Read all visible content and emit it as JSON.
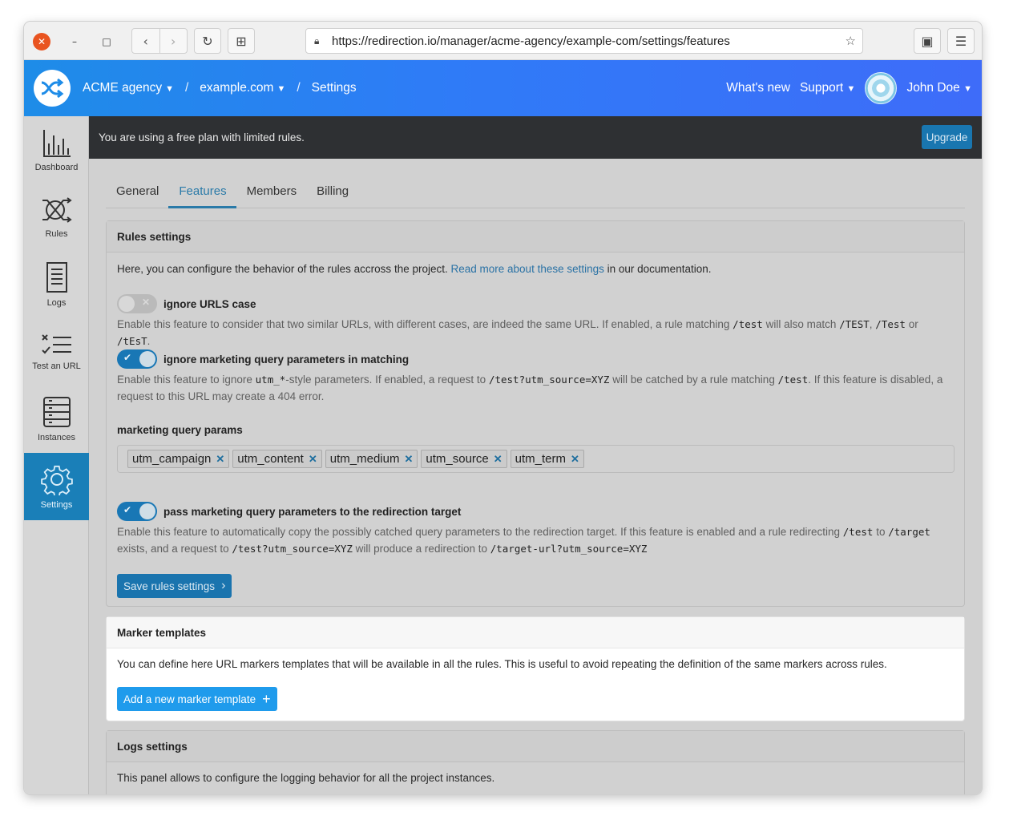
{
  "browser": {
    "url": "https://redirection.io/manager/acme-agency/example-com/settings/features"
  },
  "header": {
    "org": "ACME agency",
    "project": "example.com",
    "section": "Settings",
    "sep": "/",
    "whats_new": "What's new",
    "support": "Support",
    "user": "John Doe"
  },
  "sidebar": {
    "items": [
      {
        "label": "Dashboard"
      },
      {
        "label": "Rules"
      },
      {
        "label": "Logs"
      },
      {
        "label": "Test an URL"
      },
      {
        "label": "Instances"
      },
      {
        "label": "Settings"
      }
    ]
  },
  "banner": {
    "text": "You are using a free plan with limited rules.",
    "upgrade": "Upgrade"
  },
  "tabs": [
    {
      "label": "General"
    },
    {
      "label": "Features"
    },
    {
      "label": "Members"
    },
    {
      "label": "Billing"
    }
  ],
  "rules_panel": {
    "title": "Rules settings",
    "intro_pre": "Here, you can configure the behavior of the rules accross the project.",
    "intro_link": "Read more about these settings",
    "intro_post": "in our documentation.",
    "ignore_case": {
      "label": "ignore URLS case",
      "enabled": false,
      "d1": "Enable this feature to consider that two similar URLs, with different cases, are indeed the same URL. If enabled, a rule matching",
      "c1": "/test",
      "d2": "will also match",
      "c2": "/TEST",
      "d3": ",",
      "c3": "/Test",
      "d4": "or",
      "c4": "/tEsT",
      "d5": "."
    },
    "ignore_marketing": {
      "label": "ignore marketing query parameters in matching",
      "enabled": true,
      "d1": "Enable this feature to ignore",
      "c1": "utm_*",
      "d2": "-style parameters. If enabled, a request to",
      "c2": "/test?utm_source=XYZ",
      "d3": "will be catched by a rule matching",
      "c3": "/test",
      "d4": ". If this feature is disabled, a request to this URL may create a 404 error."
    },
    "params_label": "marketing query params",
    "params": [
      "utm_campaign",
      "utm_content",
      "utm_medium",
      "utm_source",
      "utm_term"
    ],
    "pass_marketing": {
      "label": "pass marketing query parameters to the redirection target",
      "enabled": true,
      "d1": "Enable this feature to automatically copy the possibly catched query parameters to the redirection target. If this feature is enabled and a rule redirecting",
      "c1": "/test",
      "d2": "to",
      "c2": "/target",
      "d3": "exists, and a request to",
      "c3": "/test?utm_source=XYZ",
      "d4": "will produce a redirection to",
      "c4": "/target-url?utm_source=XYZ"
    },
    "save": "Save rules settings"
  },
  "marker_panel": {
    "title": "Marker templates",
    "text": "You can define here URL markers templates that will be available in all the rules. This is useful to avoid repeating the definition of the same markers across rules.",
    "add": "Add a new marker template"
  },
  "logs_panel": {
    "title": "Logs settings",
    "text": "This panel allows to configure the logging behavior for all the project instances."
  },
  "colors": {
    "header_start": "#1e8ce8",
    "header_end": "#3e6cf9",
    "accent": "#1f9bec",
    "active_tab": "#2a7aa8"
  }
}
